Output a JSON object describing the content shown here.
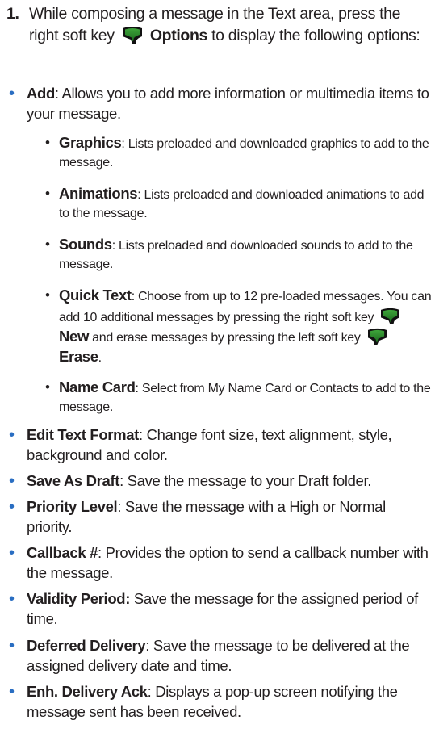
{
  "step": {
    "number": "1.",
    "intro": "While composing a message in the Text area, press the right soft key",
    "options_label": "Options",
    "tail": "to display the following options:"
  },
  "items": [
    {
      "term": "Add",
      "desc": ": Allows you to add more information or multimedia items to your message."
    },
    {
      "term": "Edit Text Format",
      "desc": ": Change font size, text alignment, style, background and color."
    },
    {
      "term": "Save As Draft",
      "desc": ": Save the message to your Draft folder."
    },
    {
      "term": "Priority Level",
      "desc": ": Save the message with a High or Normal priority."
    },
    {
      "term": "Callback #",
      "desc": ": Provides the option to send a callback number with the message."
    },
    {
      "term": "Validity Period:",
      "desc": " Save the message for the assigned period of time."
    },
    {
      "term": "Deferred Delivery",
      "desc": ": Save the message to be delivered at the assigned delivery date and time."
    },
    {
      "term": "Enh. Delivery Ack",
      "desc": ": Displays a pop-up screen notifying the message sent has been received."
    }
  ],
  "subitems": [
    {
      "term": "Graphics",
      "desc": ": Lists preloaded and downloaded graphics to add to the message."
    },
    {
      "term": "Animations",
      "desc": ": Lists preloaded and downloaded animations to add to the message."
    },
    {
      "term": "Sounds",
      "desc": ": Lists preloaded and downloaded sounds to add to the message."
    },
    {
      "term": "Name Card",
      "desc": ": Select from My Name Card or Contacts to add to the message."
    }
  ],
  "quick_text": {
    "term": "Quick Text",
    "desc": ": Choose from up to 12 pre-loaded messages. You can add 10 additional messages by pressing the right soft key",
    "new_label": "New",
    "mid": "and erase messages by pressing the left soft key",
    "erase_label": "Erase",
    "end": "."
  },
  "bullet_color": "#2a6ec2",
  "icons": {
    "right_soft_key": "right-soft-key-icon",
    "left_soft_key": "left-soft-key-icon"
  }
}
